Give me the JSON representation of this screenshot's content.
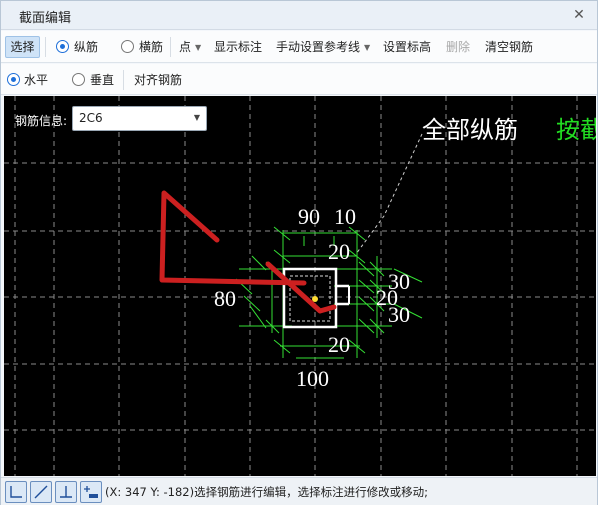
{
  "window": {
    "title": "截面编辑"
  },
  "toolbar1": {
    "select": "选择",
    "longitudinal": "纵筋",
    "transverse": "横筋",
    "point": "点",
    "show_annotation": "显示标注",
    "manual_ref_line": "手动设置参考线",
    "set_elevation": "设置标高",
    "delete": "删除",
    "clear_rebar": "清空钢筋"
  },
  "toolbar2": {
    "horizontal": "水平",
    "vertical": "垂直",
    "align_rebar": "对齐钢筋"
  },
  "rebar_info": {
    "label": "钢筋信息:",
    "value": "2C6"
  },
  "canvas": {
    "label_all": "全部纵筋",
    "label_by": "按截",
    "dims": {
      "d90": "90",
      "d10": "10",
      "d20_top": "20",
      "d30_a": "30",
      "d20_mid": "20",
      "d30_b": "30",
      "d80": "80",
      "d20_bottom": "20",
      "d100": "100"
    }
  },
  "status": {
    "text": "(X: 347 Y: -182)选择钢筋进行编辑，选择标注进行修改或移动;"
  },
  "colors": {
    "canvas_bg": "#000000",
    "grid": "#8a8a8a",
    "dim": "#35e035",
    "rebar_red": "#cc2020",
    "section": "#ffffff",
    "label_green": "#22dd22"
  }
}
